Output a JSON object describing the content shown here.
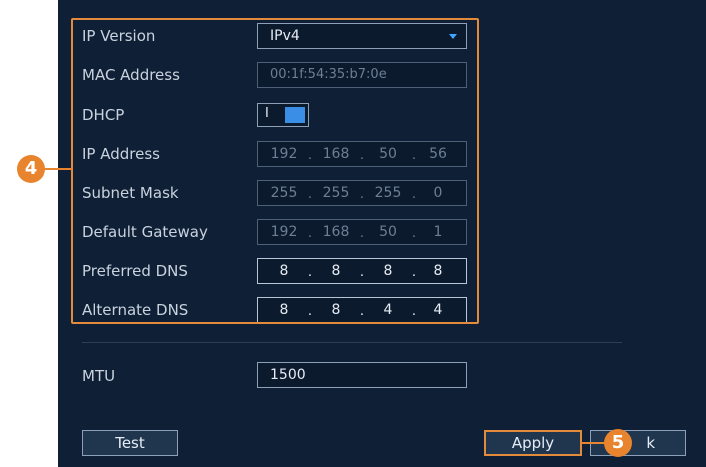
{
  "form": {
    "ip_version": {
      "label": "IP Version",
      "value": "IPv4"
    },
    "mac_address": {
      "label": "MAC Address",
      "value": "00:1f:54:35:b7:0e"
    },
    "dhcp": {
      "label": "DHCP",
      "state_mark": "I"
    },
    "ip_address": {
      "label": "IP Address",
      "octets": [
        "192",
        "168",
        "50",
        "56"
      ]
    },
    "subnet_mask": {
      "label": "Subnet Mask",
      "octets": [
        "255",
        "255",
        "255",
        "0"
      ]
    },
    "default_gateway": {
      "label": "Default Gateway",
      "octets": [
        "192",
        "168",
        "50",
        "1"
      ]
    },
    "preferred_dns": {
      "label": "Preferred DNS",
      "octets": [
        "8",
        "8",
        "8",
        "8"
      ]
    },
    "alternate_dns": {
      "label": "Alternate DNS",
      "octets": [
        "8",
        "8",
        "4",
        "4"
      ]
    },
    "mtu": {
      "label": "MTU",
      "value": "1500"
    }
  },
  "buttons": {
    "test": "Test",
    "apply": "Apply",
    "back_partial": "k"
  },
  "callouts": {
    "step4": "4",
    "step5": "5"
  },
  "colors": {
    "panel_bg": "#0f2036",
    "accent_orange": "#e8842d",
    "toggle_on": "#3a8ee6",
    "dropdown_arrow": "#3fa4ff"
  },
  "icons": {
    "dropdown": "chevron-down-icon"
  }
}
